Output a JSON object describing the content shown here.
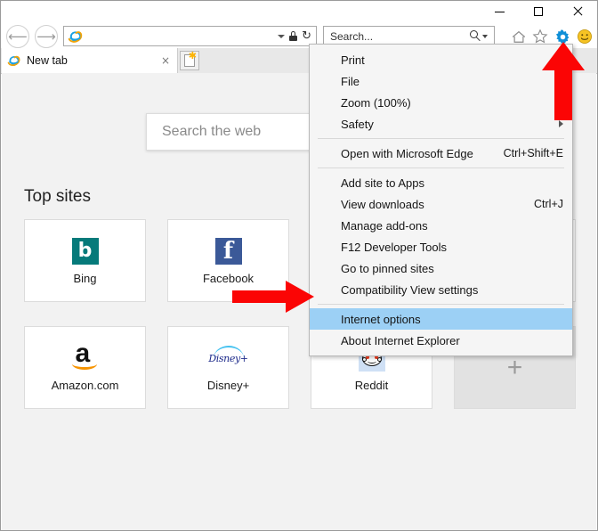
{
  "window": {
    "minimize_label": "–",
    "maximize_label": "□",
    "close_label": "✕"
  },
  "navigation": {
    "back_glyph": "⟵",
    "forward_glyph": "⟶",
    "address_value": "",
    "address_placeholder": "",
    "search_value": "",
    "search_placeholder": "Search...",
    "icons": {
      "ie_logo": "ie-logo-icon",
      "dropdown": "chevron-down-icon",
      "lock": "lock-icon",
      "refresh": "↻",
      "home": "home-icon",
      "favorites": "star-icon",
      "settings": "gear-icon",
      "feedback": "smiley-face-icon"
    },
    "gear_color": "#0f8fd7",
    "smiley_color": "#f6c324"
  },
  "tabs": {
    "items": [
      {
        "title": "New tab",
        "close_label": "×",
        "favicon": "ie-logo-icon"
      }
    ],
    "new_tab_label": "New tab button",
    "new_tab_star": "✱"
  },
  "page": {
    "search_placeholder": "Search the web",
    "search_value": "",
    "top_sites_heading": "Top sites",
    "tiles": [
      {
        "label": "Bing",
        "icon": "bing-logo-icon",
        "letter": "b"
      },
      {
        "label": "Facebook",
        "icon": "facebook-logo-icon",
        "letter": "f"
      },
      {
        "label": "Amazon.com",
        "icon": "amazon-logo-icon",
        "letter": "a"
      },
      {
        "label": "Disney+",
        "icon": "disney-plus-logo-icon",
        "letter": "Disney+"
      },
      {
        "label": "Reddit",
        "icon": "reddit-logo-icon",
        "letter": ""
      }
    ],
    "add_tile_label": "+"
  },
  "menu": {
    "items": [
      {
        "label": "Print",
        "shortcut": "",
        "submenu": false,
        "selected": false,
        "separator_after": false
      },
      {
        "label": "File",
        "shortcut": "",
        "submenu": false,
        "selected": false,
        "separator_after": false
      },
      {
        "label": "Zoom (100%)",
        "shortcut": "",
        "submenu": false,
        "selected": false,
        "separator_after": false
      },
      {
        "label": "Safety",
        "shortcut": "",
        "submenu": true,
        "selected": false,
        "separator_after": true
      },
      {
        "label": "Open with Microsoft Edge",
        "shortcut": "Ctrl+Shift+E",
        "submenu": false,
        "selected": false,
        "separator_after": true
      },
      {
        "label": "Add site to Apps",
        "shortcut": "",
        "submenu": false,
        "selected": false,
        "separator_after": false
      },
      {
        "label": "View downloads",
        "shortcut": "Ctrl+J",
        "submenu": false,
        "selected": false,
        "separator_after": false
      },
      {
        "label": "Manage add-ons",
        "shortcut": "",
        "submenu": false,
        "selected": false,
        "separator_after": false
      },
      {
        "label": "F12 Developer Tools",
        "shortcut": "",
        "submenu": false,
        "selected": false,
        "separator_after": false
      },
      {
        "label": "Go to pinned sites",
        "shortcut": "",
        "submenu": false,
        "selected": false,
        "separator_after": false
      },
      {
        "label": "Compatibility View settings",
        "shortcut": "",
        "submenu": false,
        "selected": false,
        "separator_after": true
      },
      {
        "label": "Internet options",
        "shortcut": "",
        "submenu": false,
        "selected": true,
        "separator_after": false
      },
      {
        "label": "About Internet Explorer",
        "shortcut": "",
        "submenu": false,
        "selected": false,
        "separator_after": false
      }
    ],
    "highlight_color": "#9cd0f5"
  },
  "annotations": {
    "color": "#fb0505",
    "arrow_up": "arrow-pointing-to-settings-gear",
    "arrow_right": "arrow-pointing-to-internet-options"
  }
}
